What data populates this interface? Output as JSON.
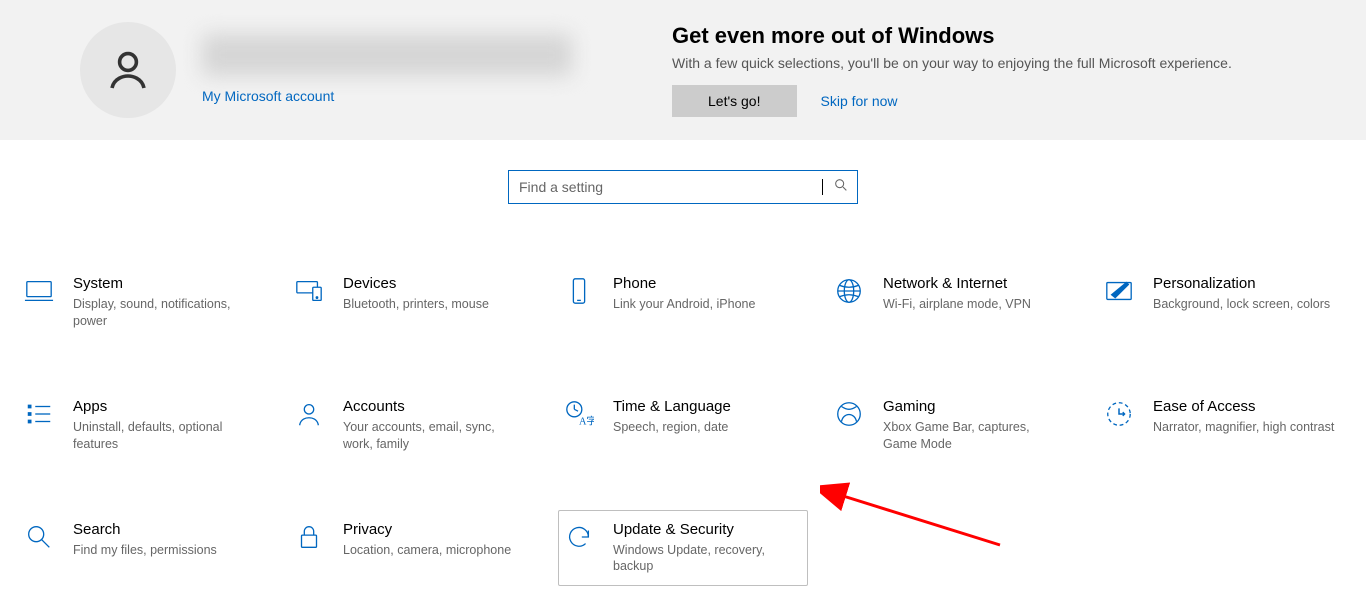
{
  "header": {
    "account_link": "My Microsoft account",
    "promo_title": "Get even more out of Windows",
    "promo_sub": "With a few quick selections, you'll be on your way to enjoying the full Microsoft experience.",
    "lets_go": "Let's go!",
    "skip": "Skip for now"
  },
  "search": {
    "placeholder": "Find a setting"
  },
  "categories": [
    {
      "title": "System",
      "desc": "Display, sound, notifications, power"
    },
    {
      "title": "Devices",
      "desc": "Bluetooth, printers, mouse"
    },
    {
      "title": "Phone",
      "desc": "Link your Android, iPhone"
    },
    {
      "title": "Network & Internet",
      "desc": "Wi-Fi, airplane mode, VPN"
    },
    {
      "title": "Personalization",
      "desc": "Background, lock screen, colors"
    },
    {
      "title": "Apps",
      "desc": "Uninstall, defaults, optional features"
    },
    {
      "title": "Accounts",
      "desc": "Your accounts, email, sync, work, family"
    },
    {
      "title": "Time & Language",
      "desc": "Speech, region, date"
    },
    {
      "title": "Gaming",
      "desc": "Xbox Game Bar, captures, Game Mode"
    },
    {
      "title": "Ease of Access",
      "desc": "Narrator, magnifier, high contrast"
    },
    {
      "title": "Search",
      "desc": "Find my files, permissions"
    },
    {
      "title": "Privacy",
      "desc": "Location, camera, microphone"
    },
    {
      "title": "Update & Security",
      "desc": "Windows Update, recovery, backup"
    }
  ]
}
